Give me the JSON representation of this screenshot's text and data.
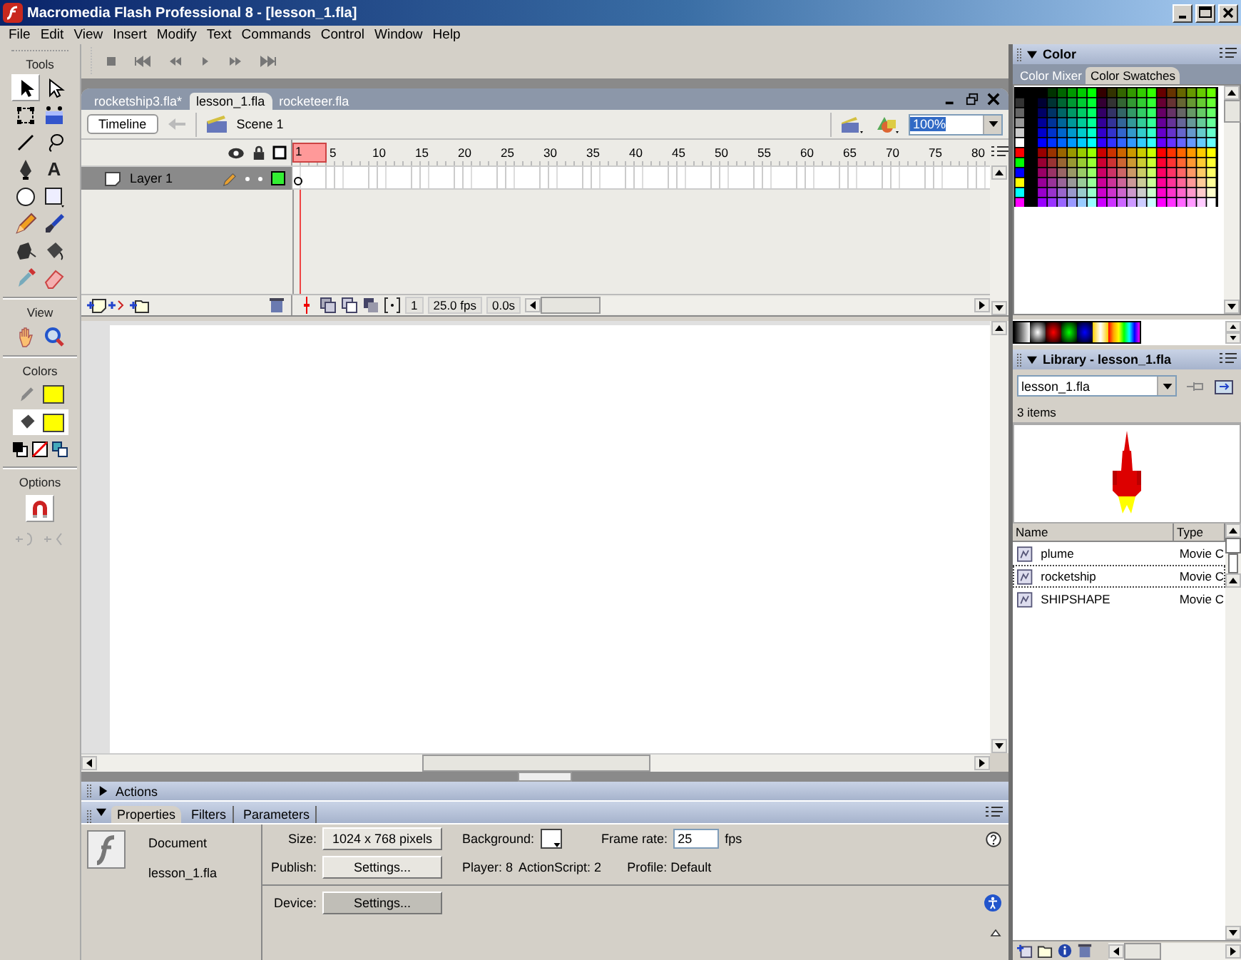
{
  "window": {
    "title": "Macromedia Flash Professional 8 - [lesson_1.fla]"
  },
  "menu": [
    "File",
    "Edit",
    "View",
    "Insert",
    "Modify",
    "Text",
    "Commands",
    "Control",
    "Window",
    "Help"
  ],
  "tools_panel": {
    "title": "Tools",
    "tools": [
      {
        "kind": "arrow",
        "selected": true
      },
      {
        "kind": "subselect",
        "selected": false
      },
      {
        "kind": "free-transform",
        "selected": false
      },
      {
        "kind": "gradient-transform",
        "selected": false
      },
      {
        "kind": "line",
        "selected": false
      },
      {
        "kind": "lasso",
        "selected": false
      },
      {
        "kind": "pen",
        "selected": false
      },
      {
        "kind": "text",
        "glyph": "A",
        "selected": false
      },
      {
        "kind": "oval",
        "selected": false
      },
      {
        "kind": "rectangle",
        "selected": false
      },
      {
        "kind": "pencil",
        "selected": false
      },
      {
        "kind": "brush",
        "selected": false
      },
      {
        "kind": "ink-bottle",
        "selected": false
      },
      {
        "kind": "paint-bucket",
        "selected": false
      },
      {
        "kind": "eyedropper",
        "selected": false
      },
      {
        "kind": "eraser",
        "selected": false
      }
    ],
    "view_label": "View",
    "view_tools": [
      {
        "kind": "hand",
        "selected": false
      },
      {
        "kind": "zoom",
        "selected": false
      }
    ],
    "colors_label": "Colors",
    "stroke": {
      "color": "#ffff00"
    },
    "fill": {
      "color": "#ffff00"
    },
    "options_label": "Options"
  },
  "doc_tabs": [
    {
      "label": "rocketship3.fla*",
      "selected": false
    },
    {
      "label": "lesson_1.fla",
      "selected": true
    },
    {
      "label": "rocketeer.fla",
      "selected": false
    }
  ],
  "timeline_bar": {
    "button": "Timeline",
    "scene": "Scene 1",
    "zoom": "100%"
  },
  "timeline": {
    "frame_numbers": [
      "1",
      "5",
      "10",
      "15",
      "20",
      "25",
      "30",
      "35",
      "40",
      "45",
      "50",
      "55",
      "60",
      "65",
      "70",
      "75",
      "80"
    ],
    "layers": [
      {
        "name": "Layer 1",
        "selected": true,
        "color": "#33ee33"
      }
    ],
    "current_frame": "1",
    "frame_rate": "25.0 fps",
    "elapsed": "0.0s"
  },
  "actions_panel": {
    "title": "Actions",
    "expanded": false
  },
  "properties_panel": {
    "expanded": true,
    "tabs": [
      {
        "label": "Properties",
        "selected": true
      },
      {
        "label": "Filters",
        "selected": false
      },
      {
        "label": "Parameters",
        "selected": false
      }
    ],
    "doc_type": "Document",
    "doc_name": "lesson_1.fla",
    "size_label": "Size:",
    "size": "1024 x 768 pixels",
    "publish_label": "Publish:",
    "publish_button": "Settings...",
    "background_label": "Background:",
    "background_swatch": {
      "color": "#ffffff"
    },
    "frame_rate_label": "Frame rate:",
    "frame_rate": "25",
    "fps_unit": "fps",
    "player": "Player: 8",
    "actionscript": "ActionScript: 2",
    "profile": "Profile: Default",
    "device_label": "Device:",
    "device_button": "Settings..."
  },
  "color_panel": {
    "title": "Color",
    "expanded": true,
    "tabs": [
      {
        "label": "Color Mixer",
        "selected": false
      },
      {
        "label": "Color Swatches",
        "selected": true
      }
    ]
  },
  "library": {
    "title": "Library - lesson_1.fla",
    "expanded": true,
    "file": "lesson_1.fla",
    "count": "3 items",
    "columns": [
      "Name",
      "Type"
    ],
    "items": [
      {
        "name": "plume",
        "type": "Movie C",
        "selected": false
      },
      {
        "name": "rocketship",
        "type": "Movie C",
        "selected": true
      },
      {
        "name": "SHIPSHAPE",
        "type": "Movie C",
        "selected": false
      }
    ]
  }
}
